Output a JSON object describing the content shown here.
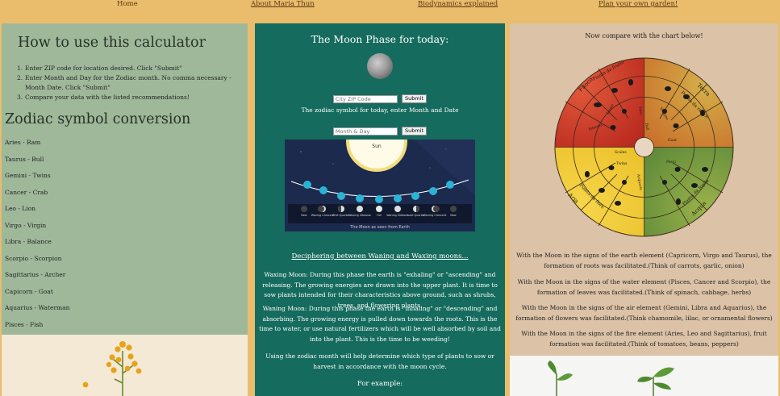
{
  "nav": {
    "home": "Home",
    "about": "About Maria Thun",
    "biodynamics": "Biodynamics explained",
    "plan": "Plan your own garden!"
  },
  "left": {
    "howto_title": "How to use this calculator",
    "steps": [
      {
        "num": "1.",
        "text": "Enter ZIP code for location desired. Click \"Submit\""
      },
      {
        "num": "2.",
        "text": "Enter Month and Day for the Zodiac month. No comma necessary - Month Date. Click \"Submit\""
      },
      {
        "num": "3.",
        "text": "Compare your data with the listed recommendations!"
      }
    ],
    "zodiac_title": "Zodiac symbol conversion",
    "zodiac_list": [
      "Aries - Ram",
      "Taurus - Bull",
      "Gemini - Twins",
      "Cancer - Crab",
      "Leo - Lion",
      "Virgo - Virgin",
      "Libra - Balance",
      "Scorpio - Scorpion",
      "Sagittarius - Archer",
      "Capicorn - Goat",
      "Aquarius - Waterman",
      "Pisces - Fish"
    ]
  },
  "middle": {
    "title": "The Moon Phase for today:",
    "zip_placeholder": "City ZIP Code",
    "submit_label": "Submit",
    "zodiac_prompt": "The zodiac symbol for today, enter Month and Date",
    "date_placeholder": "Month & Day",
    "moon_chart": {
      "sun_label": "Sun",
      "phases": [
        "New",
        "Waxing Crescent",
        "First Quarter",
        "Waxing Gibbous",
        "Full",
        "Waning Gibbous",
        "Last Quarter",
        "Waning Crescent",
        "New"
      ],
      "caption": "The Moon as seen from Earth"
    },
    "deciphering": "Deciphering between Waning and Waxing moons...",
    "waxing_text": "Waxing Moon: During this phase the earth is \"exhaling\" or \"ascending\" and releasing. The growing energies are drawn into the upper plant. It is time to sow plants intended for their characteristics above ground, such as shrubs, trees, and flowering plants.",
    "waning_text": "Waning Moon: During this phase the earth is \"inhaling\" or \"descending\" and absorbing. The growing energy is pulled down towards the roots. This is the time to water, or use natural fertilizers which will be well absorbed by soil and into the plant. This is the time to be weeding!",
    "usage_text": "Using the zodiac month will help determine which type of plants to sow or harvest in accordance with the moon cycle.",
    "for_example": "For example:"
  },
  "right": {
    "title": "Now compare with the chart below!",
    "wheel": {
      "outer_labels": [
        "Fuoco",
        "Terra",
        "Acqua",
        "Aria"
      ],
      "plant_labels": [
        "Pianta da frutto",
        "Pianta da radice",
        "Pianta da foglia",
        "Pianta da fiore"
      ],
      "sign_labels": [
        "Leone",
        "Bilancia",
        "Scales",
        "Toro",
        "Vergine",
        "Gemelli",
        "Capric.",
        "Pesci",
        "Cancro",
        "Scorpione",
        "Sagitt.",
        "Acquario",
        "Ariete",
        "Goat",
        "Bull",
        "Twins"
      ],
      "colors": {
        "fire": "#c0392b",
        "earth": "#c98a2e",
        "water": "#6f8f3a",
        "air": "#f0c93a"
      }
    },
    "earth_text": "With the Moon in the signs of the earth element (Capricorn, Virgo and Taurus), the formation of roots was facilitated.(Think of carrots, garlic, onion)",
    "water_text": "With the Moon in the signs of the water element (Pisces, Cancer and Scorpio), the formation of leaves was facilitated.(Think of spinach, cabbage, herbs)",
    "air_text": "With the Moon in the signs of the air element (Gemini, Libra and Aquarius), the formation of flowers was facilitated.(Think chamomile, lilac, or ornamental flowers)",
    "fire_text": "With the Moon in the signs of the fire element (Aries, Leo and Sagittarius), fruit formation was facilitated.(Think of tomatoes, beans, peppers)"
  }
}
